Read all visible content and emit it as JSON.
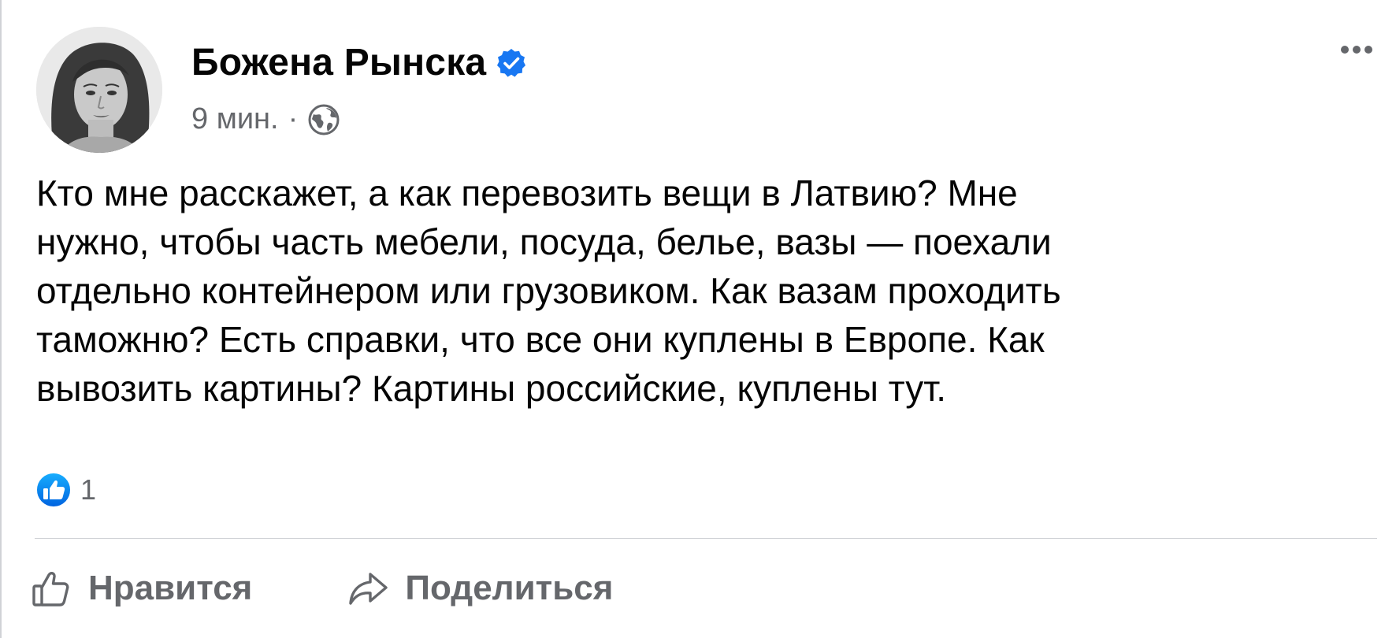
{
  "post": {
    "author": "Божена Рынска",
    "time": "9 мин.",
    "separator": "·",
    "icons": {
      "verified": "verified-badge-icon",
      "audience": "globe-icon",
      "menu": "more-options-icon",
      "reaction": "like-reaction-icon",
      "like_action": "thumbs-up-icon",
      "share_action": "share-arrow-icon"
    },
    "text_lines": [
      "Кто мне расскажет, а как перевозить вещи в Латвию? Мне",
      "нужно, чтобы часть мебели, посуда, белье, вазы — поехали",
      "отдельно контейнером или грузовиком. Как вазам проходить",
      "таможню? Есть справки, что все они куплены в Европе. Как",
      "вывозить картины? Картины российские, куплены тут."
    ],
    "reaction_count": "1"
  },
  "actions": {
    "like": "Нравится",
    "share": "Поделиться"
  },
  "colors": {
    "accent_blue": "#1877f2",
    "text_primary": "#050505",
    "text_secondary": "#65676b",
    "divider": "#ced0d4"
  }
}
